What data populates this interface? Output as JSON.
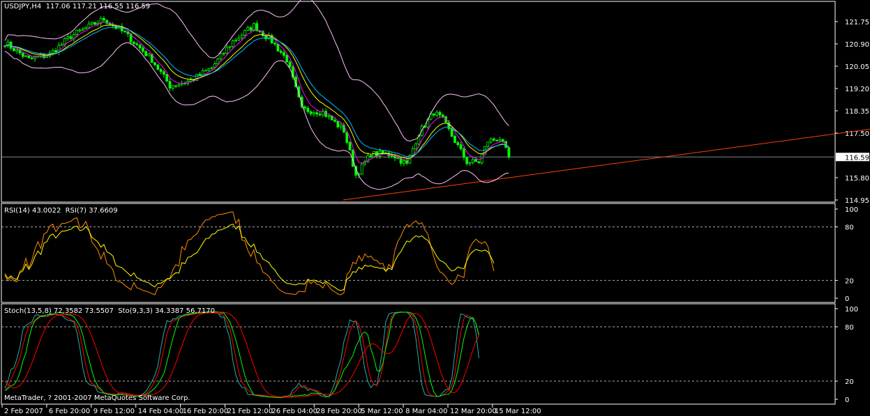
{
  "header": {
    "symbol": "USDJPY,H4",
    "ohlc": "117.06 117.21 116.55 116.59"
  },
  "rsi_header": "RSI(14) 43.0022  RSI(7) 37.6609",
  "stoch_header": "Stoch(13,5,8) 72.3582 73.5507  Sto(9,3,3) 34.3387 56.7170",
  "copyright": "MetaTrader, ? 2001-2007 MetaQuotes Software Corp.",
  "colors": {
    "bull": "#00ff00",
    "bear": "#00ff00",
    "ma1": "#ff00ff",
    "ma2": "#ffff00",
    "ma3": "#00bfff",
    "bands": "#ffc0ff",
    "trend": "#ff4000",
    "rsi14": "#ffff00",
    "rsi7": "#ff8c00",
    "stoch_main": "#20b2aa",
    "stoch_sig": "#ff0000",
    "sto2_main": "#00ff00",
    "sto2_sig": "#ff0000"
  },
  "chart_data": {
    "type": "candlestick",
    "price_axis": {
      "ticks": [
        "121.75",
        "120.90",
        "120.05",
        "119.20",
        "118.35",
        "117.50",
        "115.80",
        "114.95"
      ],
      "current": "116.59",
      "range": [
        114.95,
        121.75
      ]
    },
    "rsi_axis": {
      "ticks": [
        "100",
        "80",
        "20",
        "0"
      ],
      "levels": [
        20,
        80
      ]
    },
    "stoch_axis": {
      "ticks": [
        "100",
        "80",
        "20",
        "0"
      ],
      "levels": [
        20,
        80
      ]
    },
    "time_labels": [
      "2 Feb 2007",
      "6 Feb 20:00",
      "9 Feb 12:00",
      "14 Feb 04:00",
      "16 Feb 20:00",
      "21 Feb 12:00",
      "26 Feb 04:00",
      "28 Feb 20:00",
      "5 Mar 12:00",
      "8 Mar 04:00",
      "12 Mar 20:00",
      "15 Mar 12:00"
    ],
    "close_keypoints": [
      [
        0,
        120.95
      ],
      [
        8,
        120.3
      ],
      [
        15,
        120.5
      ],
      [
        22,
        121.2
      ],
      [
        33,
        121.85
      ],
      [
        40,
        121.3
      ],
      [
        49,
        120.3
      ],
      [
        55,
        119.3
      ],
      [
        62,
        119.5
      ],
      [
        69,
        120.0
      ],
      [
        76,
        121.0
      ],
      [
        83,
        121.6
      ],
      [
        89,
        121.0
      ],
      [
        94,
        120.3
      ],
      [
        99,
        118.4
      ],
      [
        106,
        118.3
      ],
      [
        113,
        117.6
      ],
      [
        117,
        115.9
      ],
      [
        122,
        116.7
      ],
      [
        129,
        116.7
      ],
      [
        134,
        116.3
      ],
      [
        138,
        117.5
      ],
      [
        143,
        118.3
      ],
      [
        146,
        118.0
      ],
      [
        150,
        117.2
      ],
      [
        154,
        116.4
      ],
      [
        158,
        116.4
      ],
      [
        161,
        117.2
      ],
      [
        165,
        117.3
      ],
      [
        168,
        116.59
      ]
    ],
    "trendline": {
      "from": [
        114.95
      ],
      "to": [
        117.65
      ]
    }
  }
}
